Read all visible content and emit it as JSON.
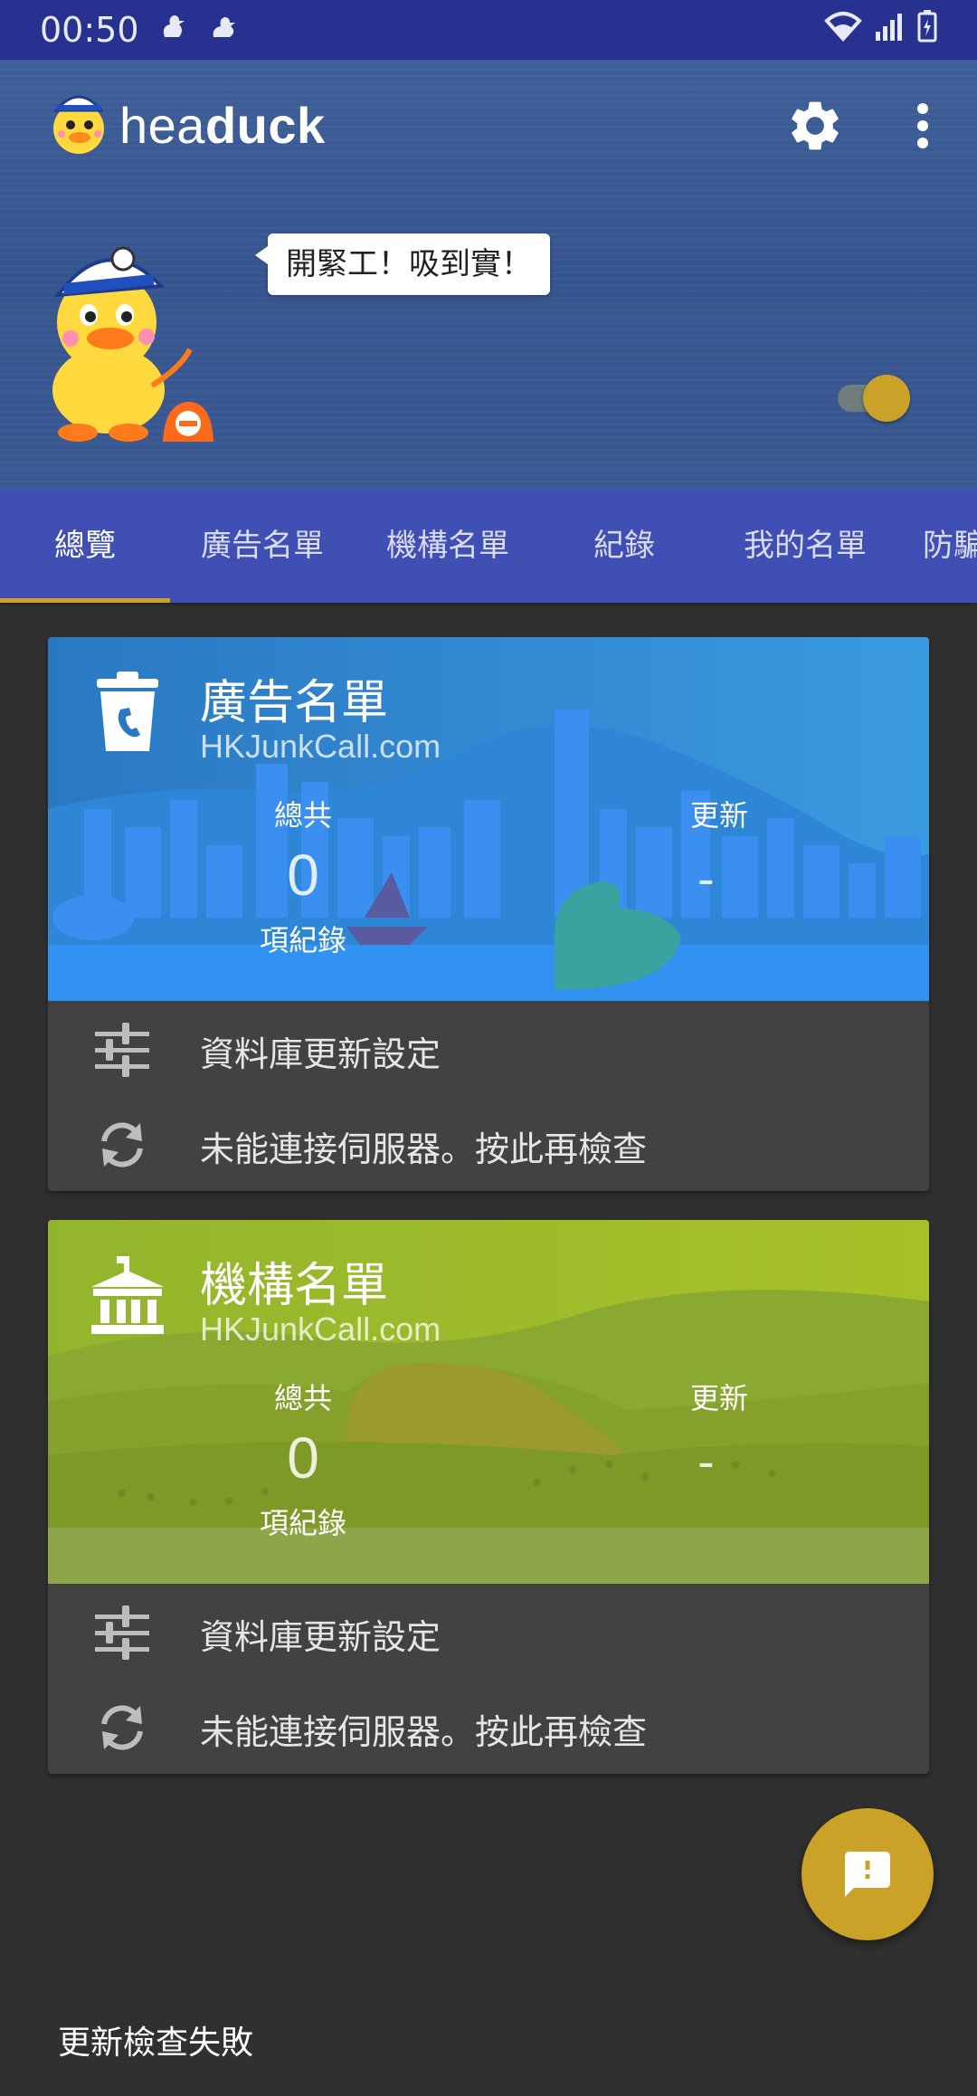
{
  "status_bar": {
    "time": "00:50"
  },
  "app": {
    "title_light": "hea",
    "title_bold": "duck",
    "speech": "開緊工！吸到實！"
  },
  "tabs": [
    {
      "label": "總覽",
      "active": true
    },
    {
      "label": "廣告名單"
    },
    {
      "label": "機構名單"
    },
    {
      "label": "紀錄"
    },
    {
      "label": "我的名單"
    },
    {
      "label": "防騙"
    }
  ],
  "cards": [
    {
      "title": "廣告名單",
      "source": "HKJunkCall.com",
      "total_label": "總共",
      "total_value": "0",
      "total_unit": "項紀錄",
      "updated_label": "更新",
      "updated_value": "-",
      "settings_label": "資料庫更新設定",
      "status_label": "未能連接伺服器。按此再檢查",
      "accent": "#2f7fd8"
    },
    {
      "title": "機構名單",
      "source": "HKJunkCall.com",
      "total_label": "總共",
      "total_value": "0",
      "total_unit": "項紀錄",
      "updated_label": "更新",
      "updated_value": "-",
      "settings_label": "資料庫更新設定",
      "status_label": "未能連接伺服器。按此再檢查",
      "accent": "#8fb12a"
    }
  ],
  "snackbar": {
    "message": "更新檢查失敗"
  },
  "colors": {
    "status_bar": "#27318f",
    "tab_bar": "#3f4fb3",
    "accent": "#c9a227",
    "background": "#303030"
  }
}
